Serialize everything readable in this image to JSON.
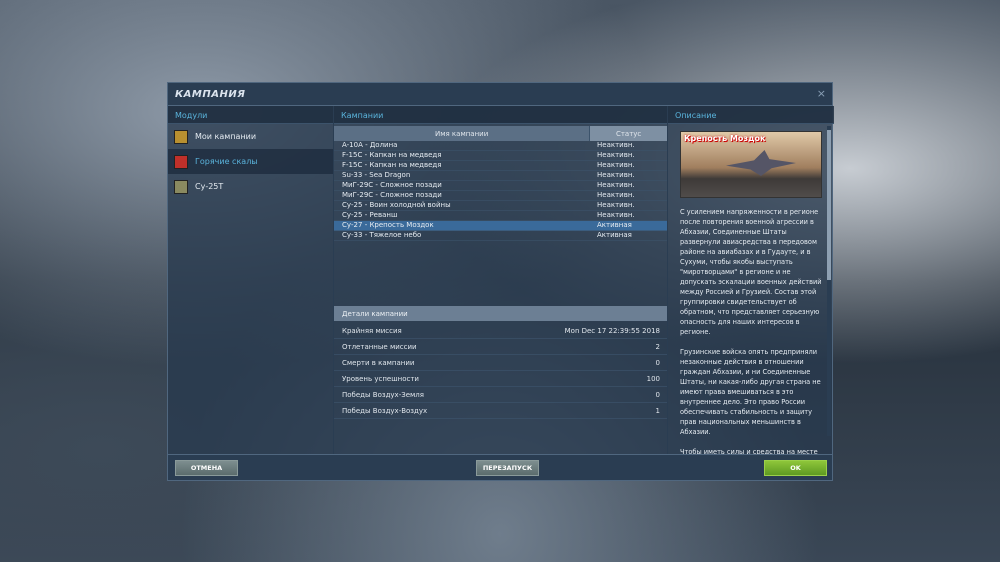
{
  "title": "КАМПАНИЯ",
  "close": "×",
  "modules": {
    "header": "Модули",
    "items": [
      {
        "label": "Мои кампании",
        "color": "#b89030"
      },
      {
        "label": "Горячие скалы",
        "color": "#c0302a"
      },
      {
        "label": "Су-25Т",
        "color": "#8a8a60"
      }
    ]
  },
  "campaigns": {
    "header": "Кампании",
    "col_name": "Имя кампании",
    "col_status": "Статус",
    "rows": [
      {
        "name": "A-10A - Долина",
        "status": "Неактивн."
      },
      {
        "name": "F-15C - Капкан на медведя",
        "status": "Неактивн."
      },
      {
        "name": "F-15C - Капкан на медведя",
        "status": "Неактивн."
      },
      {
        "name": "Su-33 - Sea Dragon",
        "status": "Неактивн."
      },
      {
        "name": "МиГ-29С - Сложное позади",
        "status": "Неактивн."
      },
      {
        "name": "МиГ-29С - Сложное позади",
        "status": "Неактивн."
      },
      {
        "name": "Су-25 - Воин холодной войны",
        "status": "Неактивн."
      },
      {
        "name": "Су-25 - Реванш",
        "status": "Неактивн."
      },
      {
        "name": "Су-27 - Крепость Моздок",
        "status": "Активная"
      },
      {
        "name": "Су-33 - Тяжелое небо",
        "status": "Активная"
      }
    ]
  },
  "details": {
    "header": "Детали кампании",
    "rows": [
      {
        "label": "Крайняя миссия",
        "value": "Mon Dec 17 22:39:55 2018"
      },
      {
        "label": "Отлетанные миссии",
        "value": "2"
      },
      {
        "label": "Смерти в кампании",
        "value": "0"
      },
      {
        "label": "Уровень успешности",
        "value": "100"
      },
      {
        "label": "Победы Воздух-Земля",
        "value": "0"
      },
      {
        "label": "Победы Воздух-Воздух",
        "value": "1"
      }
    ]
  },
  "description": {
    "header": "Описание",
    "image_caption": "Крепость Моздок",
    "paragraphs": [
      "С усилением напряженности в регионе после повторения военной агрессии в Абхазии, Соединенные Штаты развернули авиасредства в передовом районе на авиабазах и в Гудауте, и в Сухуми, чтобы якобы выступать \"миротворцами\" в регионе и не допускать эскалации военных действий между Россией и Грузией. Состав этой группировки свидетельствует об обратном, что представляет серьезную опасность для наших интересов в регионе.",
      "Грузинские войска опять предприняли незаконные действия в отношении граждан Абхазии, и ни Соединенные Штаты, ни какая-либо другая страна не имеют права вмешиваться в это внутреннее дело. Это право России обеспечивать стабильность и защиту прав национальных меньшинств в Абхазии.",
      "Чтобы иметь силы и средства на месте для эффективного противодействия вмешательству извне, часть 3-го"
    ]
  },
  "buttons": {
    "cancel": "ОТМЕНА",
    "restart": "ПЕРЕЗАПУСК",
    "ok": "OK"
  }
}
